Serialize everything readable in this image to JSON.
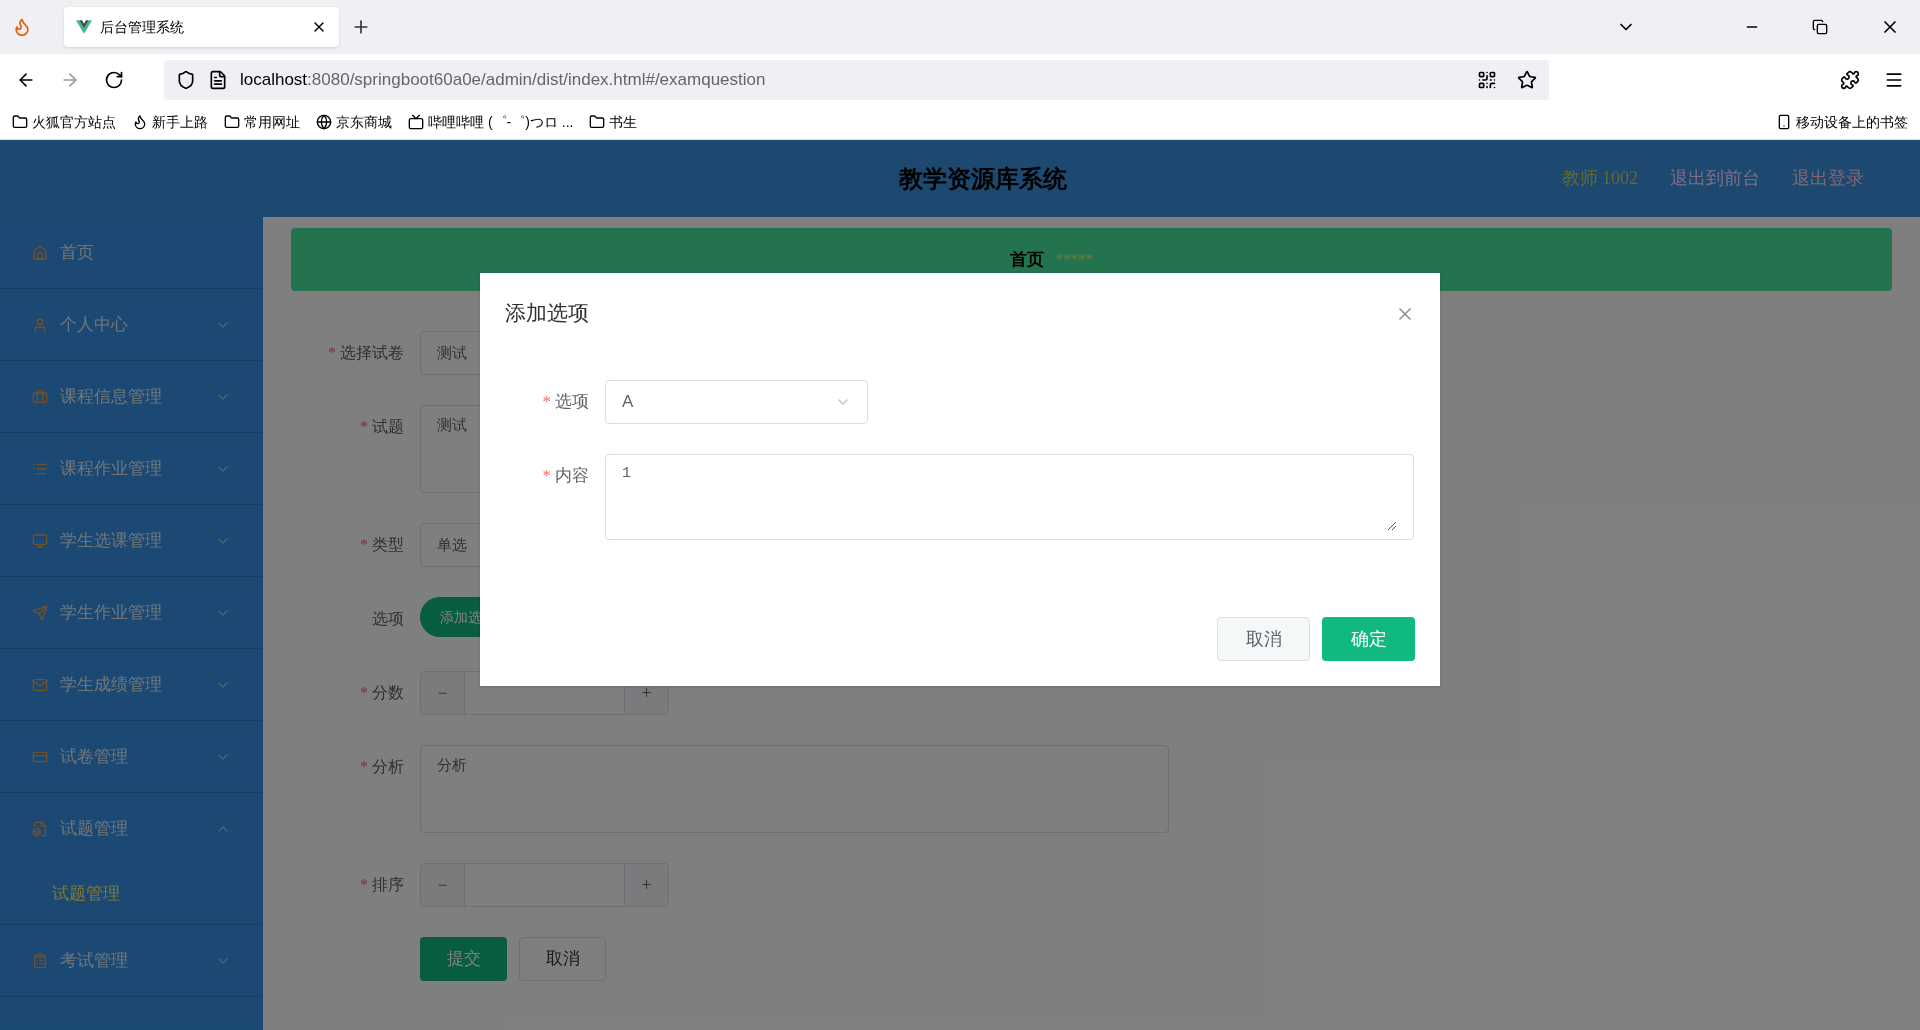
{
  "browser": {
    "tab_title": "后台管理系统",
    "url_host": "localhost",
    "url_path": ":8080/springboot60a0e/admin/dist/index.html#/examquestion",
    "bookmarks": [
      "火狐官方站点",
      "新手上路",
      "常用网址",
      "京东商城",
      "哔哩哔哩 (゜-゜)つロ ...",
      "书生"
    ],
    "mobile_bookmarks": "移动设备上的书签"
  },
  "header": {
    "title": "教学资源库系统",
    "user": "教师 1002",
    "links": [
      "退出到前台",
      "退出登录"
    ]
  },
  "sidebar": {
    "items": [
      {
        "label": "首页",
        "kind": "link"
      },
      {
        "label": "个人中心",
        "kind": "submenu",
        "expanded": false
      },
      {
        "label": "课程信息管理",
        "kind": "submenu",
        "expanded": false
      },
      {
        "label": "课程作业管理",
        "kind": "submenu",
        "expanded": false
      },
      {
        "label": "学生选课管理",
        "kind": "submenu",
        "expanded": false
      },
      {
        "label": "学生作业管理",
        "kind": "submenu",
        "expanded": false
      },
      {
        "label": "学生成绩管理",
        "kind": "submenu",
        "expanded": false
      },
      {
        "label": "试卷管理",
        "kind": "submenu",
        "expanded": false
      },
      {
        "label": "试题管理",
        "kind": "submenu",
        "expanded": true,
        "children": [
          {
            "label": "试题管理",
            "selected": true
          }
        ]
      },
      {
        "label": "考试管理",
        "kind": "submenu",
        "expanded": false
      }
    ]
  },
  "breadcrumb": {
    "items": [
      "首页"
    ],
    "mark": "*****"
  },
  "form": {
    "fields": [
      {
        "label": "选择试卷",
        "required": true,
        "kind": "select",
        "value": "测试"
      },
      {
        "label": "试题",
        "required": true,
        "kind": "textarea",
        "value": "测试"
      },
      {
        "label": "类型",
        "required": true,
        "kind": "select",
        "value": "单选"
      },
      {
        "label": "选项",
        "required": false,
        "kind": "button",
        "value": "添加选"
      },
      {
        "label": "分数",
        "required": true,
        "kind": "number"
      },
      {
        "label": "分析",
        "required": true,
        "kind": "textarea",
        "placeholder": "分析"
      },
      {
        "label": "排序",
        "required": true,
        "kind": "number"
      }
    ],
    "required_mark": "*",
    "buttons": [
      "提交",
      "取消"
    ],
    "stepper": [
      "−",
      "+"
    ]
  },
  "dialog": {
    "title": "添加选项",
    "fields": [
      {
        "label": "选项",
        "required": true,
        "kind": "select",
        "value": "A"
      },
      {
        "label": "内容",
        "required": true,
        "kind": "textarea",
        "value": "1"
      }
    ],
    "required_mark": "*",
    "buttons": [
      "取消",
      "确定"
    ]
  }
}
